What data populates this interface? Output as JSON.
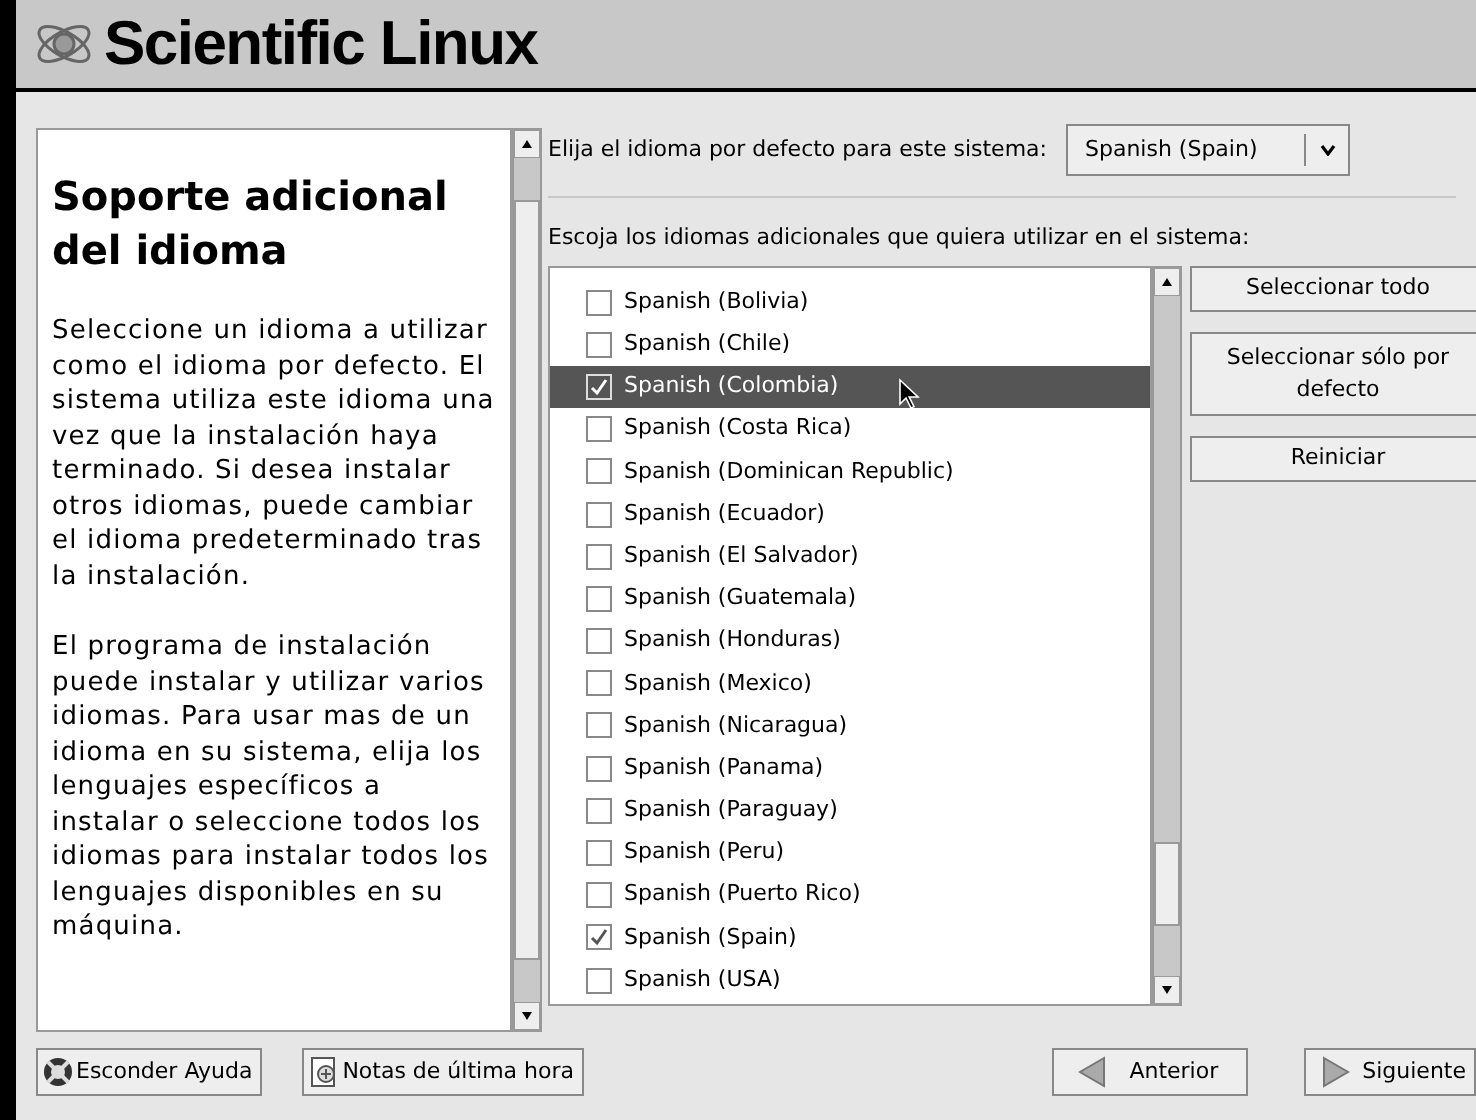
{
  "header": {
    "title": "Scientific Linux"
  },
  "help": {
    "title": "Soporte adicional del idioma",
    "paragraphs": [
      "Seleccione un idioma a utilizar como el idioma por defecto. El sistema utiliza este idioma una vez que la instalación haya terminado. Si desea instalar otros idiomas, puede cambiar el idioma predeterminado tras la instalación.",
      "El programa de instalación puede instalar y utilizar varios idiomas. Para usar mas de un idioma en su sistema, elija los lenguajes específicos a instalar o seleccione todos los idiomas para instalar todos los lenguajes disponibles en su máquina."
    ]
  },
  "default_language": {
    "label": "Elija el idioma por defecto para este sistema:",
    "value": "Spanish (Spain)"
  },
  "additional_label": "Escoja los idiomas adicionales que quiera utilizar en el sistema:",
  "languages": [
    {
      "label": "Spanish (Bolivia)",
      "checked": false,
      "selected": false
    },
    {
      "label": "Spanish (Chile)",
      "checked": false,
      "selected": false
    },
    {
      "label": "Spanish (Colombia)",
      "checked": true,
      "selected": true
    },
    {
      "label": "Spanish (Costa Rica)",
      "checked": false,
      "selected": false
    },
    {
      "label": "Spanish (Dominican Republic)",
      "checked": false,
      "selected": false
    },
    {
      "label": "Spanish (Ecuador)",
      "checked": false,
      "selected": false
    },
    {
      "label": "Spanish (El Salvador)",
      "checked": false,
      "selected": false
    },
    {
      "label": "Spanish (Guatemala)",
      "checked": false,
      "selected": false
    },
    {
      "label": "Spanish (Honduras)",
      "checked": false,
      "selected": false
    },
    {
      "label": "Spanish (Mexico)",
      "checked": false,
      "selected": false
    },
    {
      "label": "Spanish (Nicaragua)",
      "checked": false,
      "selected": false
    },
    {
      "label": "Spanish (Panama)",
      "checked": false,
      "selected": false
    },
    {
      "label": "Spanish (Paraguay)",
      "checked": false,
      "selected": false
    },
    {
      "label": "Spanish (Peru)",
      "checked": false,
      "selected": false
    },
    {
      "label": "Spanish (Puerto Rico)",
      "checked": false,
      "selected": false
    },
    {
      "label": "Spanish (Spain)",
      "checked": true,
      "selected": false
    },
    {
      "label": "Spanish (USA)",
      "checked": false,
      "selected": false
    }
  ],
  "side_buttons": [
    "Seleccionar todo",
    "Seleccionar sólo por defecto",
    "Reiniciar"
  ],
  "footer_buttons": [
    {
      "label": "Esconder Ayuda",
      "kind": "help"
    },
    {
      "label": "Notas de última hora",
      "kind": "notes"
    },
    {
      "label": "Anterior",
      "kind": "back"
    },
    {
      "label": "Siguiente",
      "kind": "next"
    }
  ]
}
